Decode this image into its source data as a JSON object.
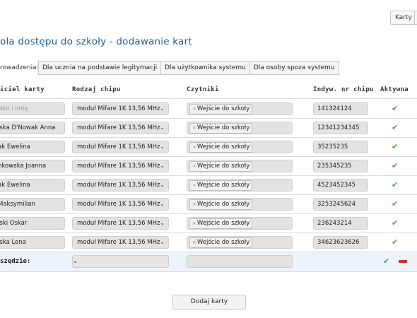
{
  "header": {
    "button_label": "Karty"
  },
  "page": {
    "title": "ola dostępu do szkoły - dodawanie kart"
  },
  "modes": {
    "label": "rowadzenia:",
    "options": [
      "Dla ucznia na podstawie legitymacji",
      "Dla użytkownika systemu",
      "Dla osoby spoza systemu"
    ]
  },
  "table": {
    "headers": [
      "iciel karty",
      "Rodzaj chipu",
      "Czytniki",
      "Indyw. nr chipu",
      "Aktywna"
    ],
    "rows": [
      {
        "owner": "isko i imię",
        "owner_is_placeholder": true,
        "chip_type": "moduł Mifare 1K 13,56 MHz",
        "reader": "Wejście do szkoły",
        "chip_no": "141324124",
        "active": true
      },
      {
        "owner": "lska D'Nowak Anna",
        "chip_type": "moduł Mifare 1K 13,56 MHz",
        "reader": "Wejście do szkoły",
        "chip_no": "12341234345",
        "active": true
      },
      {
        "owner": "ak Ewelina",
        "chip_type": "moduł Mifare 1K 13,56 MHz",
        "reader": "Wejście do szkoły",
        "chip_no": "35235235",
        "active": true
      },
      {
        "owner": "nkowska Joanna",
        "chip_type": "moduł Mifare 1K 13,56 MHz",
        "reader": "Wejście do szkoły",
        "chip_no": "235345235",
        "active": true
      },
      {
        "owner": "ak Ewelina",
        "chip_type": "moduł Mifare 1K 13,56 MHz",
        "reader": "Wejście do szkoły",
        "chip_no": "4523452345",
        "active": true
      },
      {
        "owner": "Maksymilian",
        "chip_type": "moduł Mifare 1K 13,56 MHz",
        "reader": "Wejście do szkoły",
        "chip_no": "3253245624",
        "active": true
      },
      {
        "owner": "lski Oskar",
        "chip_type": "moduł Mifare 1K 13,56 MHz",
        "reader": "Wejście do szkoły",
        "chip_no": "236243214",
        "active": true
      },
      {
        "owner": "lska Lena",
        "chip_type": "moduł Mifare 1K 13,56 MHz",
        "reader": "Wejście do szkoły",
        "chip_no": "34623623626",
        "active": true
      }
    ],
    "bulk": {
      "label": "szędzie:"
    }
  },
  "actions": {
    "submit_label": "Dodaj karty"
  },
  "icons": {
    "check": "check-icon",
    "remove": "minus-icon",
    "tag_remove": "close-icon",
    "dropdown": "chevron-down-icon"
  },
  "colors": {
    "title": "#1f5e96",
    "check": "#46a843",
    "remove": "#d9262a",
    "bulk_bg": "#edf3fa"
  }
}
